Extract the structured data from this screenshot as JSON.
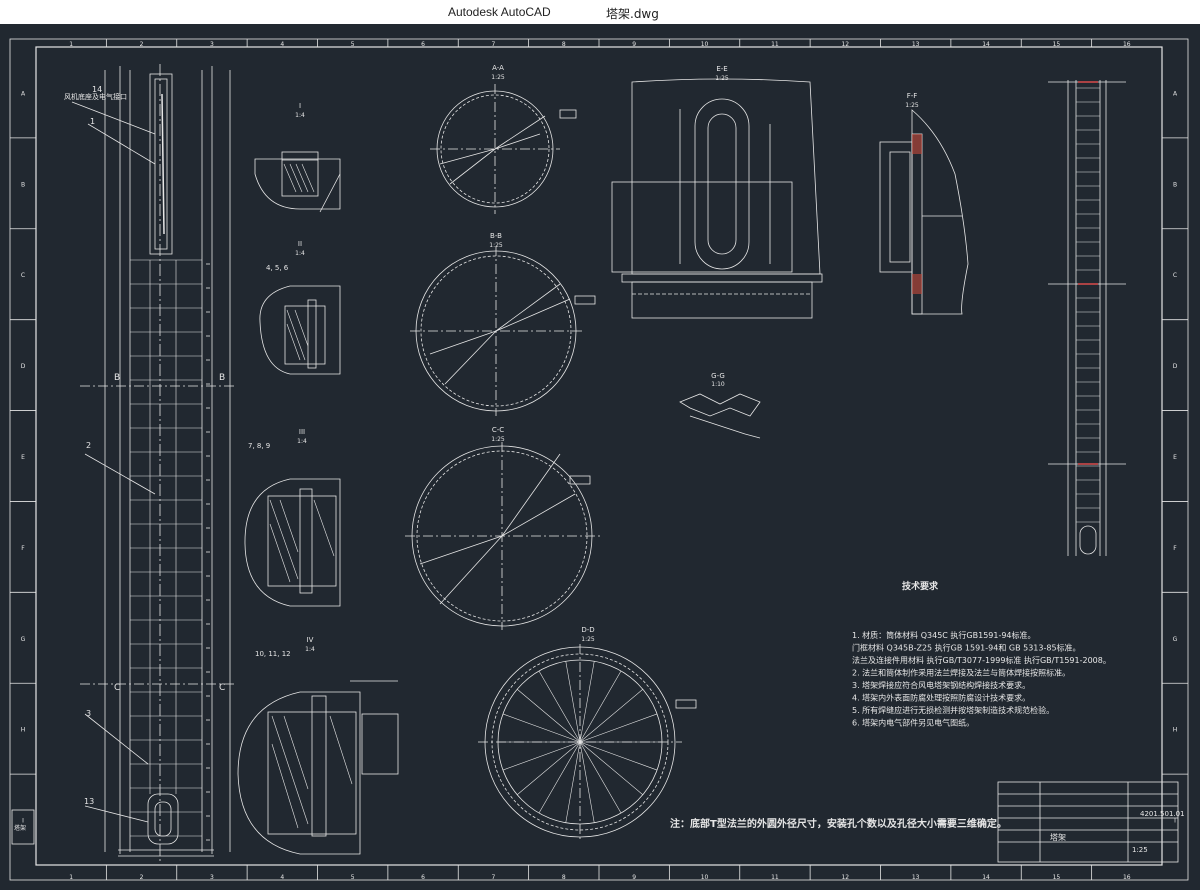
{
  "window": {
    "app_name": "Autodesk AutoCAD",
    "document_name": "塔架.dwg"
  },
  "drawing": {
    "colors": {
      "background": "#212830",
      "line": "#e6e6e6",
      "accent_red": "#d94a4a"
    },
    "grid_columns": [
      "1",
      "2",
      "3",
      "4",
      "5",
      "6",
      "7",
      "8",
      "9",
      "10",
      "11",
      "12",
      "13",
      "14",
      "15",
      "16"
    ],
    "grid_rows": [
      "A",
      "B",
      "C",
      "D",
      "E",
      "F",
      "G",
      "H",
      "I"
    ],
    "section_marks": {
      "b_left": "B",
      "b_right": "B",
      "c_left": "C",
      "c_right": "C"
    },
    "callouts": {
      "c1": "1",
      "c14": "14",
      "c2": "2",
      "c3": "3",
      "c13": "13"
    },
    "note_chain": "风机底座及电气接口",
    "views": {
      "I": "I",
      "I_scale": "1:4",
      "II": "II",
      "II_scale": "1:4",
      "III": "III",
      "III_scale": "1:4",
      "IV": "IV",
      "IV_scale": "1:4",
      "AA": "A-A",
      "AA_scale": "1:25",
      "BB": "B-B",
      "BB_scale": "1:25",
      "CC": "C-C",
      "CC_scale": "1:25",
      "DD": "D-D",
      "DD_scale": "1:25",
      "EE": "E-E",
      "EE_scale": "1:25",
      "FF": "F-F",
      "FF_scale": "1:25",
      "GG": "G-G",
      "GG_scale": "1:10"
    },
    "bolt_labels": {
      "b456": "4, 5, 6",
      "b789": "7, 8, 9",
      "b101112": "10, 11, 12"
    },
    "tech": {
      "title": "技术要求",
      "lines": [
        "1. 材质：筒体材料 Q345C 执行GB1591-94标准。",
        "          门框材料 Q345B-Z25 执行GB 1591-94和 GB 5313-85标准。",
        "          法兰及连接件用材料 执行GB/T3077-1999标准 执行GB/T1591-2008。",
        "2. 法兰和筒体制作采用法兰焊接及法兰与筒体焊接按照标准。",
        "3. 塔架焊接应符合风电塔架钢结构焊接技术要求。",
        "4. 塔架内外表面防腐处理按照防腐设计技术要求。",
        "5. 所有焊缝应进行无损检测并按塔架制造技术规范检验。",
        "6. 塔架内电气部件另见电气图纸。"
      ]
    },
    "bottom_note": "注：底部T型法兰的外圆外径尺寸，安装孔个数以及孔径大小需要三维确定。",
    "title_block": {
      "drawing_no": "4201.501.01",
      "name": "塔架",
      "scale": "1:25"
    },
    "left_stamp": "塔架"
  }
}
